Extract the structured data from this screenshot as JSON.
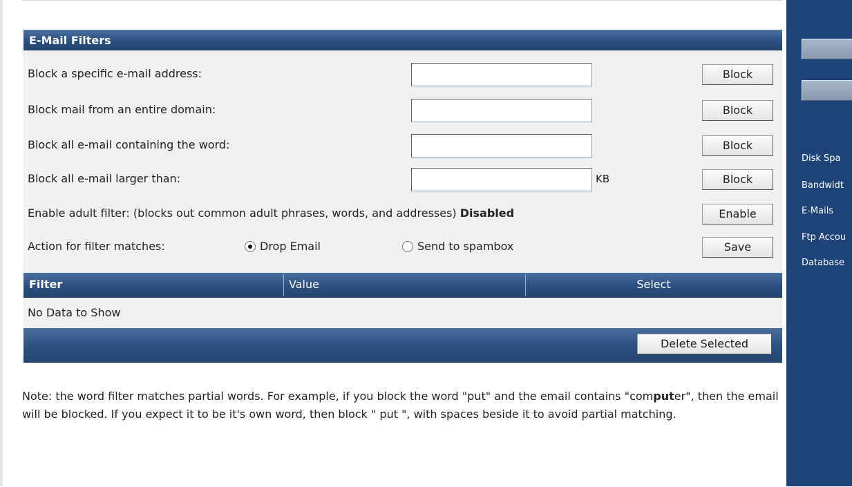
{
  "panel": {
    "title": "E-Mail Filters"
  },
  "rows": [
    {
      "label": "Block a specific e-mail address:",
      "input_value": "",
      "unit": "",
      "button": "Block"
    },
    {
      "label": "Block mail from an entire domain:",
      "input_value": "",
      "unit": "",
      "button": "Block"
    },
    {
      "label": "Block all e-mail containing the word:",
      "input_value": "",
      "unit": "",
      "button": "Block"
    },
    {
      "label": "Block all e-mail larger than:",
      "input_value": "",
      "unit": "KB",
      "button": "Block"
    }
  ],
  "adult_filter": {
    "label": "Enable adult filter: (blocks out common adult phrases, words, and addresses)",
    "status": "Disabled",
    "button": "Enable"
  },
  "action": {
    "label": "Action for filter matches:",
    "options": [
      "Drop Email",
      "Send to spambox"
    ],
    "selected": "Drop Email",
    "button": "Save"
  },
  "table": {
    "columns": [
      "Filter",
      "Value",
      "Select"
    ],
    "empty_text": "No Data to Show",
    "delete_button": "Delete Selected"
  },
  "note": {
    "part1": "Note: the word filter matches partial words. For example, if you block the word \"put\" and the email contains \"com",
    "bold": "put",
    "part2": "er\", then the email will be blocked. If you expect it to be it's own word, then block \" put \", with spaces beside it to avoid partial matching."
  },
  "sidebar": {
    "stats": [
      "Disk Spa",
      "Bandwidt",
      "E-Mails",
      "Ftp Accou",
      "Database"
    ]
  },
  "colors": {
    "header_blue": "#2b4f80",
    "sidebar_blue": "#1e4378",
    "form_bg": "#f0f0f0"
  }
}
